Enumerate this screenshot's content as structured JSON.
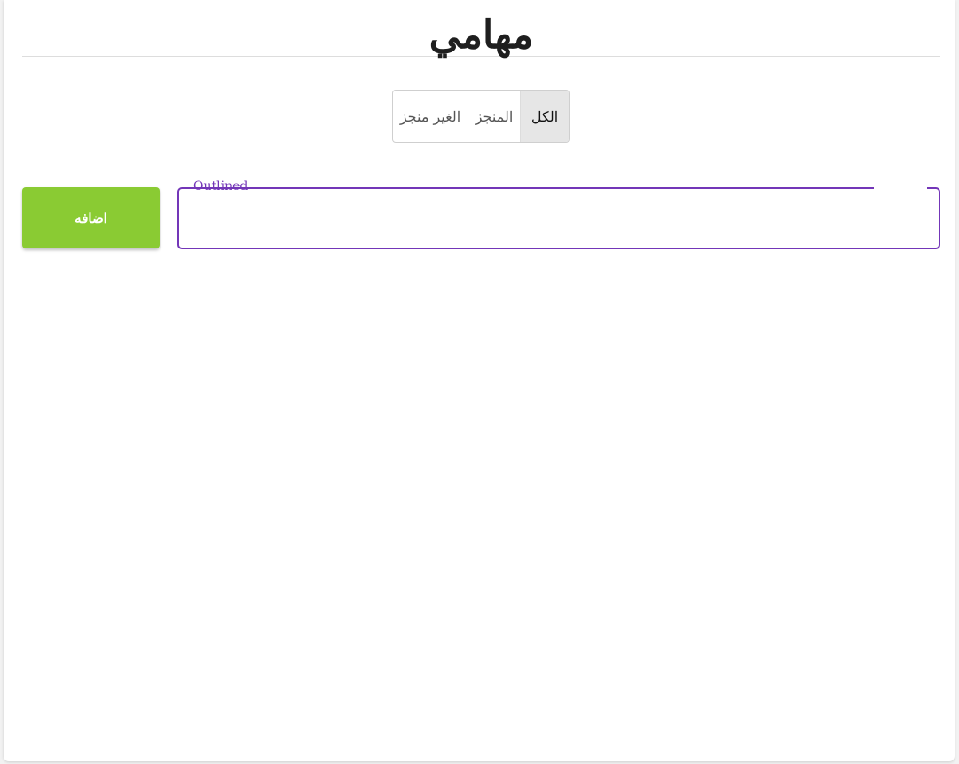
{
  "header": {
    "title": "مهامي"
  },
  "filters": [
    {
      "label": "الغير منجز",
      "selected": false
    },
    {
      "label": "المنجز",
      "selected": false
    },
    {
      "label": "الكل",
      "selected": true
    }
  ],
  "add_button": {
    "label": "اضافه",
    "color": "#8acb33"
  },
  "task_input": {
    "label": "Outlined",
    "value": "",
    "accent_color": "#7336b8"
  }
}
